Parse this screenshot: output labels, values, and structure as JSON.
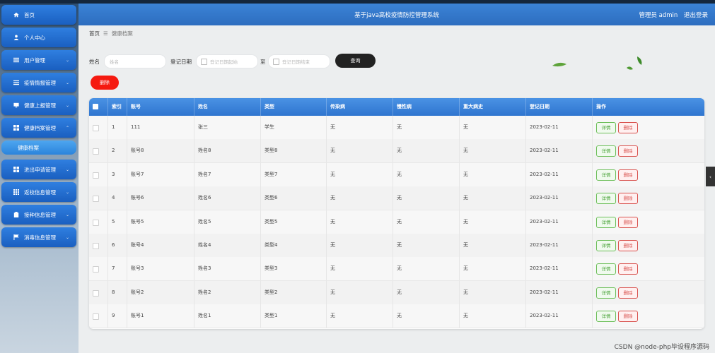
{
  "app": {
    "title": "基于java高校疫情防控管理系统",
    "user_label": "管理员 admin",
    "logout_label": "退出登录"
  },
  "sidebar": {
    "items": [
      {
        "label": "首页",
        "icon": "home-icon"
      },
      {
        "label": "个人中心",
        "icon": "user-icon"
      },
      {
        "label": "用户管理",
        "icon": "list-icon"
      },
      {
        "label": "疫情情报管理",
        "icon": "list-icon"
      },
      {
        "label": "健康上报管理",
        "icon": "monitor-icon"
      },
      {
        "label": "健康档案管理",
        "icon": "grid-icon"
      },
      {
        "label": "健康档案",
        "icon": ""
      },
      {
        "label": "进出申请管理",
        "icon": "grid-icon"
      },
      {
        "label": "返校信息管理",
        "icon": "apps-icon"
      },
      {
        "label": "接种信息管理",
        "icon": "clipboard-icon"
      },
      {
        "label": "消毒信息管理",
        "icon": "flag-icon"
      }
    ]
  },
  "breadcrumb": {
    "home": "首页",
    "separator": "☰",
    "current": "健康档案"
  },
  "filters": {
    "name_label": "姓名",
    "name_placeholder": "姓名",
    "date_label": "登记日期",
    "date_start_placeholder": "登记日期起始",
    "to_label": "至",
    "date_end_placeholder": "登记日期结束",
    "search_label": "查询",
    "delete_label": "删除"
  },
  "table": {
    "columns": [
      "索引",
      "账号",
      "姓名",
      "类型",
      "传染病",
      "慢性病",
      "重大病史",
      "登记日期",
      "操作"
    ],
    "rows": [
      {
        "idx": "1",
        "account": "111",
        "name": "张三",
        "type": "学生",
        "infect": "无",
        "chronic": "无",
        "major": "无",
        "date": "2023-02-11"
      },
      {
        "idx": "2",
        "account": "账号8",
        "name": "姓名8",
        "type": "类型8",
        "infect": "无",
        "chronic": "无",
        "major": "无",
        "date": "2023-02-11"
      },
      {
        "idx": "3",
        "account": "账号7",
        "name": "姓名7",
        "type": "类型7",
        "infect": "无",
        "chronic": "无",
        "major": "无",
        "date": "2023-02-11"
      },
      {
        "idx": "4",
        "account": "账号6",
        "name": "姓名6",
        "type": "类型6",
        "infect": "无",
        "chronic": "无",
        "major": "无",
        "date": "2023-02-11"
      },
      {
        "idx": "5",
        "account": "账号5",
        "name": "姓名5",
        "type": "类型5",
        "infect": "无",
        "chronic": "无",
        "major": "无",
        "date": "2023-02-11"
      },
      {
        "idx": "6",
        "account": "账号4",
        "name": "姓名4",
        "type": "类型4",
        "infect": "无",
        "chronic": "无",
        "major": "无",
        "date": "2023-02-11"
      },
      {
        "idx": "7",
        "account": "账号3",
        "name": "姓名3",
        "type": "类型3",
        "infect": "无",
        "chronic": "无",
        "major": "无",
        "date": "2023-02-11"
      },
      {
        "idx": "8",
        "account": "账号2",
        "name": "姓名2",
        "type": "类型2",
        "infect": "无",
        "chronic": "无",
        "major": "无",
        "date": "2023-02-11"
      },
      {
        "idx": "9",
        "account": "账号1",
        "name": "姓名1",
        "type": "类型1",
        "infect": "无",
        "chronic": "无",
        "major": "无",
        "date": "2023-02-11"
      }
    ],
    "detail_label": "详情",
    "row_delete_label": "删除"
  },
  "edge_tab_label": "‹",
  "watermark": "CSDN @node-php毕设程序源码",
  "colors": {
    "header_blue": "#3b83d6",
    "nav_blue": "#2f7fe0",
    "delete_red": "#f51a10",
    "search_black": "#222222"
  }
}
